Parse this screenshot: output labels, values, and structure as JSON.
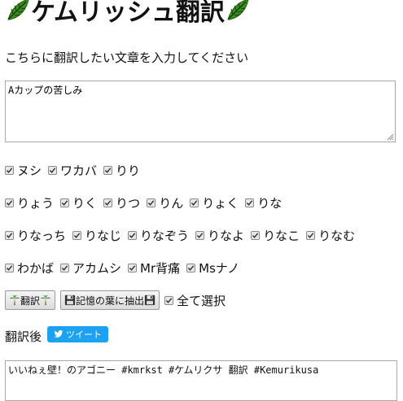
{
  "header": {
    "title": "ケムリッシュ翻訳",
    "leaf_icon": "leaf-icon"
  },
  "prompt": "こちらに翻訳したい文章を入力してください",
  "input": {
    "value": "Aカップの苦しみ"
  },
  "checkbox_rows": [
    [
      "ヌシ",
      "ワカバ",
      "りり"
    ],
    [
      "りょう",
      "りく",
      "りつ",
      "りん",
      "りょく",
      "りな"
    ],
    [
      "りなっち",
      "りなじ",
      "りなぞう",
      "りなよ",
      "りなこ",
      "りなむ"
    ],
    [
      "わかば",
      "アカムシ",
      "Mr背痛",
      "Msナノ"
    ]
  ],
  "buttons": {
    "translate_label": "翻訳",
    "save_label": "記憶の葉に抽出",
    "select_all_label": "全て選択"
  },
  "output": {
    "label": "翻訳後",
    "tweet_label": "ツイート",
    "value": "いいねぇ壁！のアゴニー #kmrkst #ケムリクサ 翻訳 #Kemurikusa"
  },
  "colors": {
    "tweet": "#1da1f2",
    "leaf": "#3f8f1f"
  }
}
